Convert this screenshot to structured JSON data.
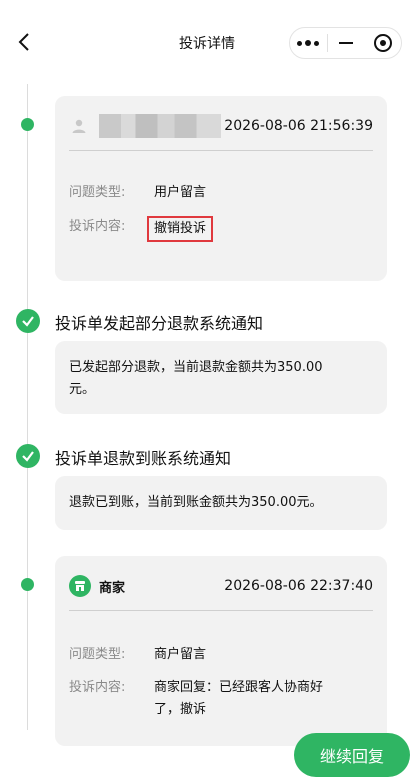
{
  "header": {
    "title": "投诉详情"
  },
  "timeline": {
    "complaint_entry": {
      "time": "2026-08-06 21:56:39",
      "type_label": "问题类型:",
      "type_value": "用户留言",
      "content_label": "投诉内容:",
      "content_value": "撤销投诉"
    },
    "partial_refund": {
      "title": "投诉单发起部分退款系统通知",
      "text_line1": "已发起部分退款，当前退款金额共为350.00",
      "text_line2": "元。"
    },
    "refund_arrived": {
      "title": "投诉单退款到账系统通知",
      "text": "退款已到账，当前到账金额共为350.00元。"
    },
    "merchant_entry": {
      "name": "商家",
      "time": "2026-08-06 22:37:40",
      "type_label": "问题类型:",
      "type_value": "商户留言",
      "content_label": "投诉内容:",
      "content_line1": "商家回复：已经跟客人协商好",
      "content_line2": "了，撤诉"
    }
  },
  "actions": {
    "reply_label": "继续回复"
  },
  "colors": {
    "accent": "#2fb563",
    "highlight_border": "#e0393e",
    "card_bg": "#f2f2f2"
  }
}
